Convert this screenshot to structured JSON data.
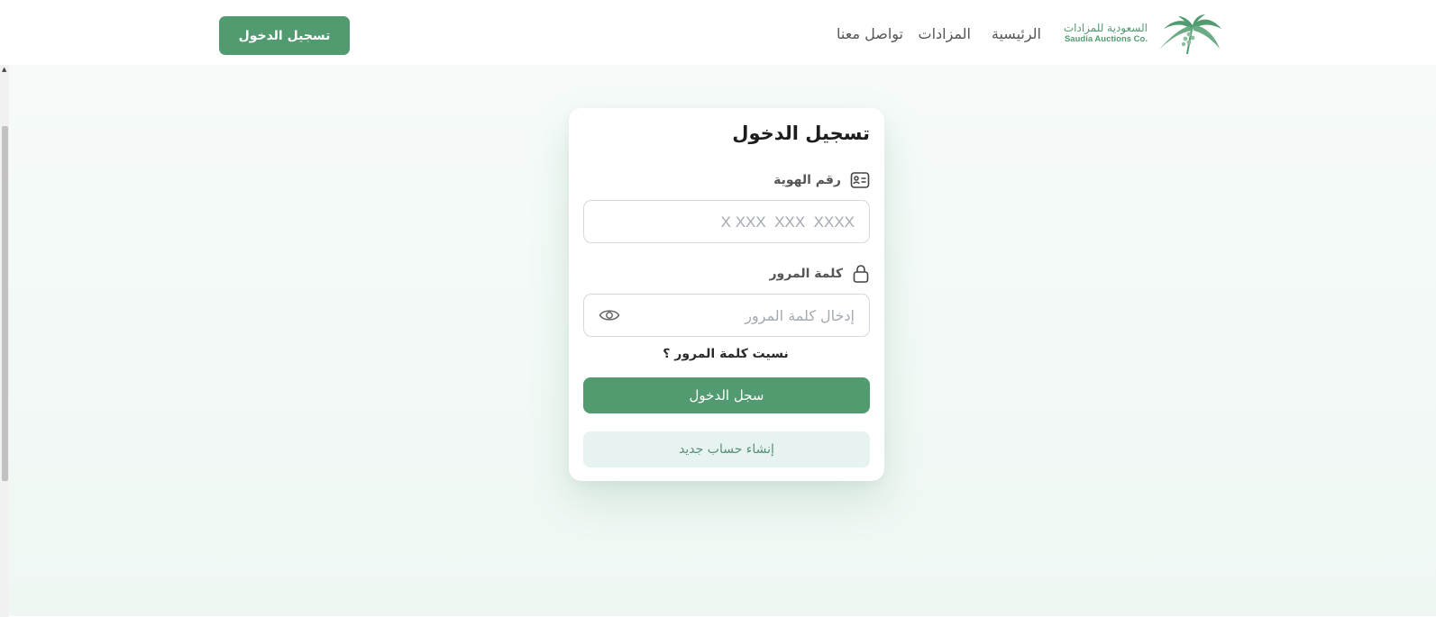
{
  "header": {
    "login_button": "تسجيل الدخول",
    "nav": [
      "الرئيسية",
      "المزادات",
      "تواصل معنا"
    ],
    "logo_ar": "السعودية للمزادات",
    "logo_en": "Saudia Auctions Co."
  },
  "login_card": {
    "title": "تسجيل الدخول",
    "id_label": "رقم الهوية",
    "id_placeholder": "X XXX  XXX  XXXX",
    "id_value": "",
    "password_label": "كلمة المرور",
    "password_placeholder": "إدخال كلمة المرور",
    "password_value": "",
    "forgot_link": "نسيت كلمة المرور ؟",
    "submit_button": "سجل الدخول",
    "create_account_button": "إنشاء حساب جديد"
  },
  "icons": {
    "id_field": "id-card-icon",
    "password_field": "lock-icon",
    "toggle_password": "eye-icon",
    "brand": "palm-icon"
  },
  "colors": {
    "primary": "#529a70",
    "secondary_bg": "#e7f3f0",
    "secondary_text": "#5a8f7a",
    "page_bg": "#f3f9f6"
  }
}
